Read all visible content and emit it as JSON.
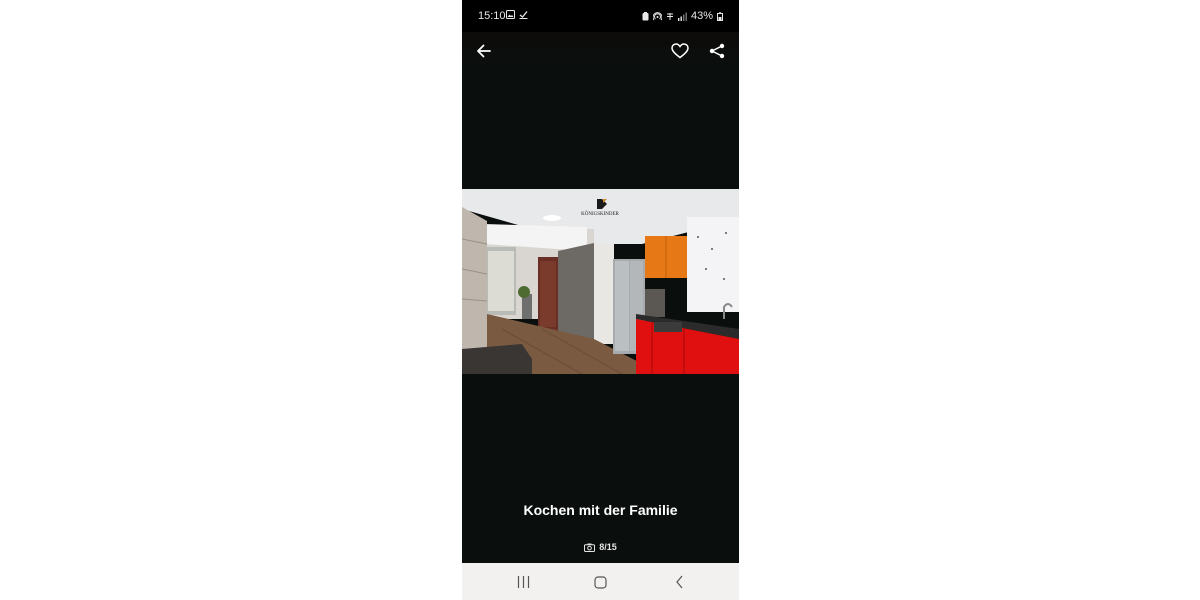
{
  "status_bar": {
    "time": "15:10",
    "battery": "43%",
    "icons_left": [
      "gallery-icon",
      "check-icon"
    ],
    "icons_right": [
      "battery-saver-icon",
      "hotspot-icon",
      "wifi-calling-icon",
      "signal-icon",
      "battery-icon"
    ]
  },
  "top_bar": {
    "icons": [
      "back-arrow-icon",
      "heart-icon",
      "share-icon"
    ]
  },
  "photo": {
    "watermark": "KÖNIGSKINDER"
  },
  "caption": "Kochen mit der Familie",
  "counter": {
    "text": "8/15",
    "icon": "camera-icon"
  },
  "system_nav": {
    "icons": [
      "recents-icon",
      "home-icon",
      "back-icon"
    ]
  },
  "colors": {
    "background": "#0a0f0d",
    "kitchen_red": "#e01010",
    "cabinet_orange": "#e67816"
  }
}
